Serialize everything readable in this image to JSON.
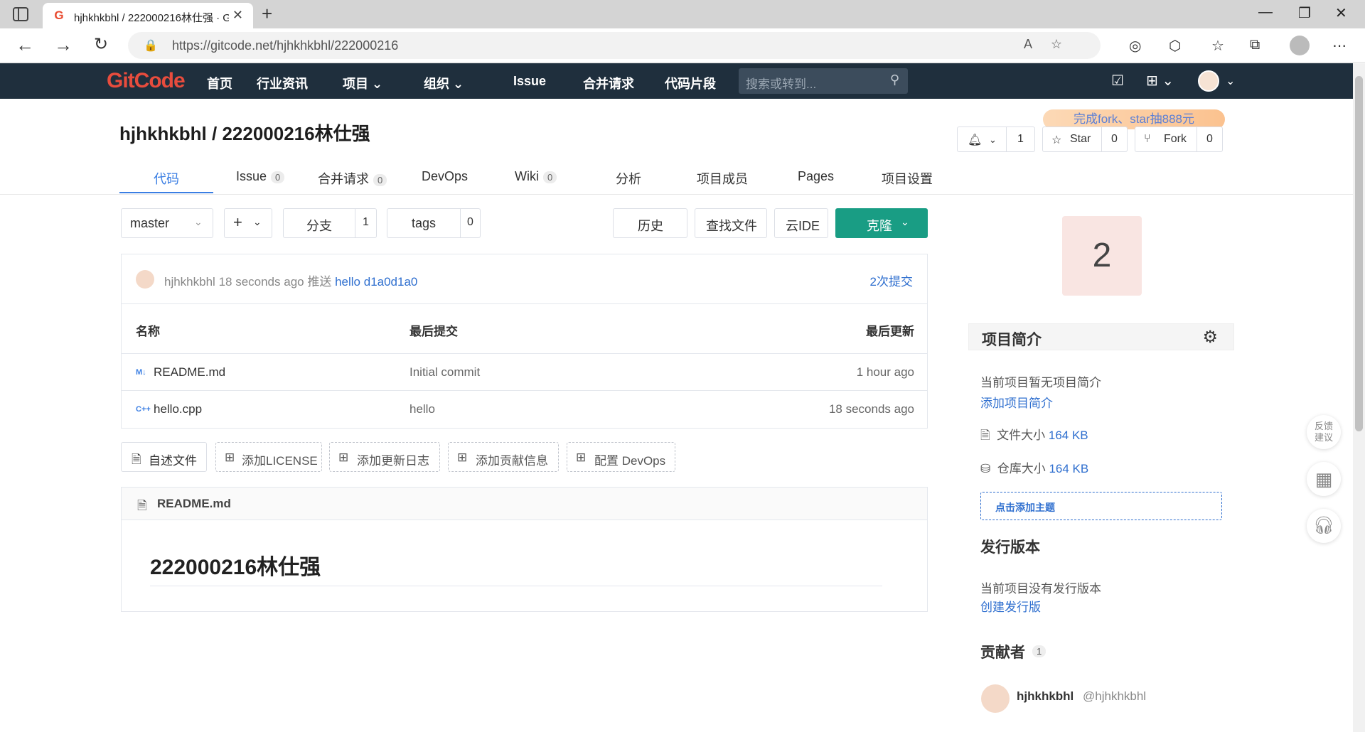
{
  "browser": {
    "tab_title": "hjhkhkbhl / 222000216林仕强 · G",
    "tab_favicon": "G",
    "url": "https://gitcode.net/hjhkhkbhl/222000216"
  },
  "site": {
    "logo": "GitCode",
    "nav": {
      "home": "首页",
      "news": "行业资讯",
      "projects": "项目",
      "orgs": "组织",
      "issue": "Issue",
      "merge": "合并请求",
      "snippets": "代码片段"
    },
    "search_placeholder": "搜索或转到..."
  },
  "project": {
    "title": "hjhkhkbhl / 222000216林仕强",
    "promo": "完成fork、star抽888元",
    "watch_count": "1",
    "star_label": "Star",
    "star_count": "0",
    "fork_label": "Fork",
    "fork_count": "0"
  },
  "tabs": {
    "code": "代码",
    "issue": "Issue",
    "issue_count": "0",
    "merge": "合并请求",
    "merge_count": "0",
    "devops": "DevOps",
    "wiki": "Wiki",
    "wiki_count": "0",
    "analysis": "分析",
    "members": "项目成员",
    "pages": "Pages",
    "settings": "项目设置"
  },
  "toolbar": {
    "branch": "master",
    "add": "+",
    "branches_label": "分支",
    "branches_count": "1",
    "tags_label": "tags",
    "tags_count": "0",
    "history": "历史",
    "find_file": "查找文件",
    "cloud_ide": "云IDE",
    "clone": "克隆"
  },
  "commit": {
    "author": "hjhkhkbhl",
    "time": "18 seconds ago",
    "action": "推送",
    "message": "hello",
    "sha": "d1a0d1a0",
    "count": "2次提交"
  },
  "table": {
    "col_name": "名称",
    "col_commit": "最后提交",
    "col_updated": "最后更新",
    "rows": [
      {
        "icon": "M↓",
        "name": "README.md",
        "commit": "Initial commit",
        "updated": "1 hour ago"
      },
      {
        "icon": "C++",
        "name": "hello.cpp",
        "commit": "hello",
        "updated": "18 seconds ago"
      }
    ]
  },
  "actions": {
    "readme": "自述文件",
    "license": "添加LICENSE",
    "changelog": "添加更新日志",
    "contrib": "添加贡献信息",
    "devops": "配置 DevOps"
  },
  "readme": {
    "filename": "README.md",
    "heading": "222000216林仕强"
  },
  "sidebar": {
    "big_number": "2",
    "intro_title": "项目简介",
    "intro_empty": "当前项目暂无项目简介",
    "intro_add": "添加项目简介",
    "file_size_label": "文件大小",
    "file_size": "164 KB",
    "repo_size_label": "仓库大小",
    "repo_size": "164 KB",
    "add_topic": "点击添加主题",
    "release_title": "发行版本",
    "release_empty": "当前项目没有发行版本",
    "release_create": "创建发行版",
    "contributors_title": "贡献者",
    "contributors_count": "1",
    "contributor_name": "hjhkhkbhl",
    "contributor_handle": "@hjhkhkbhl"
  },
  "float": {
    "feedback": "反馈建议"
  }
}
